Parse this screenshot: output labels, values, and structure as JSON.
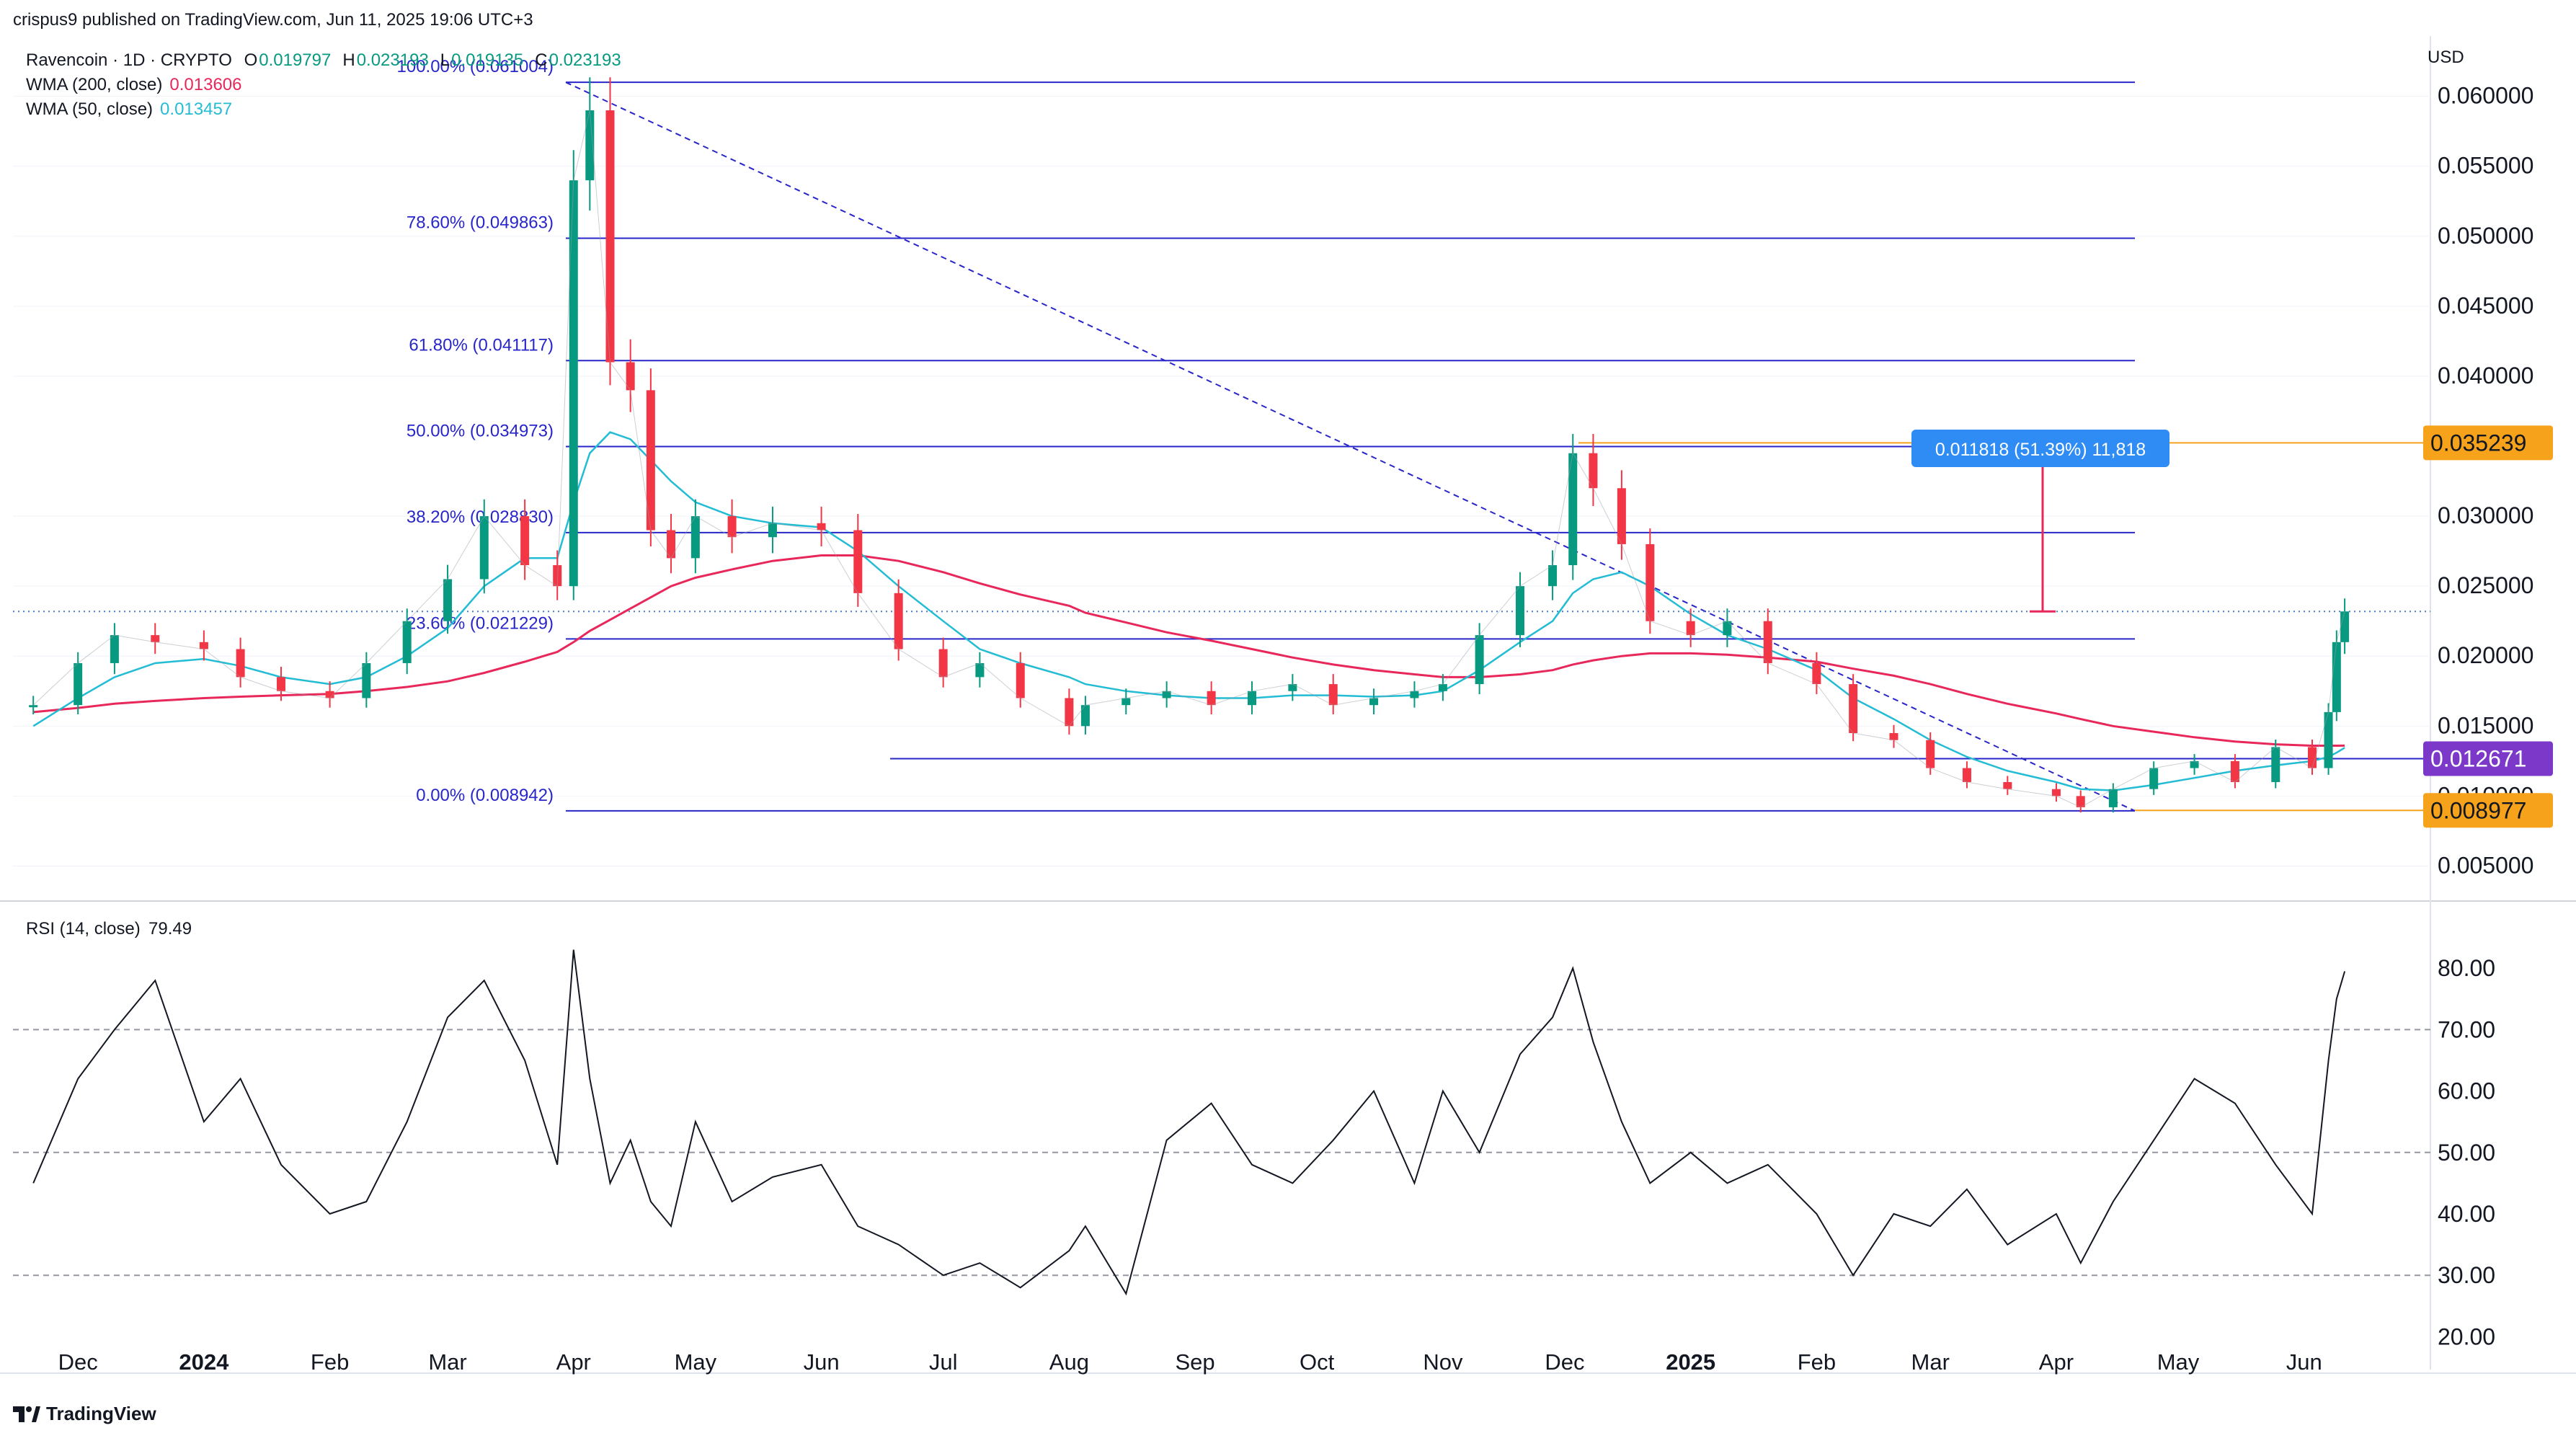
{
  "header": {
    "published": "crispus9 published on TradingView.com, Jun 11, 2025 19:06 UTC+3"
  },
  "symbol": {
    "name": "Ravencoin · 1D · CRYPTO",
    "ohlc": [
      {
        "k": "O",
        "v": "0.019797"
      },
      {
        "k": "H",
        "v": "0.023193"
      },
      {
        "k": "L",
        "v": "0.019135"
      },
      {
        "k": "C",
        "v": "0.023193"
      }
    ]
  },
  "indicators": [
    {
      "label": "WMA (200, close)",
      "value": "0.013606",
      "color": "#e8275a"
    },
    {
      "label": "WMA (50, close)",
      "value": "0.013457",
      "color": "#26bcd3"
    }
  ],
  "currency": "USD",
  "colors": {
    "up": "#089981",
    "down": "#f23645",
    "wma200": "#e8275a",
    "wma50": "#22bcd4",
    "fib": "#2826c9",
    "support_label": "#7b38c9",
    "orange": "#f7a21b",
    "measure": "#e8275a",
    "measure_label": "#2f8cf5",
    "grid": "#f0f3fa",
    "text": "#131722"
  },
  "price_axis": {
    "ticks": [
      "0.060000",
      "0.055000",
      "0.050000",
      "0.045000",
      "0.040000",
      "0.030000",
      "0.025000",
      "0.020000",
      "0.015000",
      "0.010000",
      "0.005000"
    ],
    "tick_values": [
      0.06,
      0.055,
      0.05,
      0.045,
      0.04,
      0.03,
      0.025,
      0.02,
      0.015,
      0.01,
      0.005
    ],
    "range": [
      0.0025,
      0.064
    ]
  },
  "highlights": [
    {
      "label": "0.035239",
      "value": 0.035239,
      "style": "orange"
    },
    {
      "label": "0.012671",
      "value": 0.012671,
      "style": "purple"
    },
    {
      "label": "0.008977",
      "value": 0.008977,
      "style": "orange"
    }
  ],
  "fib_levels": [
    {
      "label": "100.00% (0.061004)",
      "value": 0.061004
    },
    {
      "label": "78.60% (0.049863)",
      "value": 0.049863
    },
    {
      "label": "61.80% (0.041117)",
      "value": 0.041117
    },
    {
      "label": "50.00% (0.034973)",
      "value": 0.034973
    },
    {
      "label": "38.20% (0.028830)",
      "value": 0.02883
    },
    {
      "label": "23.60% (0.021229)",
      "value": 0.021229
    },
    {
      "label": "0.00% (0.008942)",
      "value": 0.008942
    }
  ],
  "measure": {
    "label": "0.011818 (51.39%) 11,818",
    "from": 0.023193,
    "to": 0.035239
  },
  "time_axis": [
    {
      "label": "Dec",
      "bold": false
    },
    {
      "label": "2024",
      "bold": true
    },
    {
      "label": "Feb",
      "bold": false
    },
    {
      "label": "Mar",
      "bold": false
    },
    {
      "label": "Apr",
      "bold": false
    },
    {
      "label": "May",
      "bold": false
    },
    {
      "label": "Jun",
      "bold": false
    },
    {
      "label": "Jul",
      "bold": false
    },
    {
      "label": "Aug",
      "bold": false
    },
    {
      "label": "Sep",
      "bold": false
    },
    {
      "label": "Oct",
      "bold": false
    },
    {
      "label": "Nov",
      "bold": false
    },
    {
      "label": "Dec",
      "bold": false
    },
    {
      "label": "2025",
      "bold": true
    },
    {
      "label": "Feb",
      "bold": false
    },
    {
      "label": "Mar",
      "bold": false
    },
    {
      "label": "Apr",
      "bold": false
    },
    {
      "label": "May",
      "bold": false
    },
    {
      "label": "Jun",
      "bold": false
    }
  ],
  "rsi": {
    "label": "RSI (14, close)",
    "value": "79.49",
    "ticks": [
      "80.00",
      "70.00",
      "60.00",
      "50.00",
      "40.00",
      "30.00",
      "20.00"
    ],
    "tick_values": [
      80,
      70,
      60,
      50,
      40,
      30,
      20
    ],
    "bands": [
      70,
      50,
      30
    ],
    "range": [
      17,
      88
    ]
  },
  "footer": {
    "brand": "TradingView"
  },
  "chart_data": {
    "type": "line",
    "title": "Ravencoin · 1D · CRYPTO",
    "xlabel": "",
    "ylabel": "",
    "ylim": [
      0.0025,
      0.064
    ],
    "x": [
      "2023-11-20",
      "2023-12-01",
      "2023-12-10",
      "2023-12-20",
      "2024-01-01",
      "2024-01-10",
      "2024-01-20",
      "2024-02-01",
      "2024-02-10",
      "2024-02-20",
      "2024-03-01",
      "2024-03-10",
      "2024-03-20",
      "2024-03-28",
      "2024-04-01",
      "2024-04-05",
      "2024-04-10",
      "2024-04-15",
      "2024-04-20",
      "2024-04-25",
      "2024-05-01",
      "2024-05-10",
      "2024-05-20",
      "2024-06-01",
      "2024-06-10",
      "2024-06-20",
      "2024-07-01",
      "2024-07-10",
      "2024-07-20",
      "2024-08-01",
      "2024-08-05",
      "2024-08-15",
      "2024-08-25",
      "2024-09-05",
      "2024-09-15",
      "2024-09-25",
      "2024-10-05",
      "2024-10-15",
      "2024-10-25",
      "2024-11-01",
      "2024-11-10",
      "2024-11-20",
      "2024-11-28",
      "2024-12-03",
      "2024-12-08",
      "2024-12-15",
      "2024-12-22",
      "2025-01-01",
      "2025-01-10",
      "2025-01-20",
      "2025-02-01",
      "2025-02-10",
      "2025-02-20",
      "2025-03-01",
      "2025-03-10",
      "2025-03-20",
      "2025-04-01",
      "2025-04-07",
      "2025-04-15",
      "2025-04-25",
      "2025-05-05",
      "2025-05-15",
      "2025-05-25",
      "2025-06-03",
      "2025-06-07",
      "2025-06-09",
      "2025-06-11"
    ],
    "series": [
      {
        "values": [
          0.0165,
          0.0195,
          0.0215,
          0.021,
          0.0205,
          0.0185,
          0.0175,
          0.017,
          0.0195,
          0.0225,
          0.0255,
          0.03,
          0.0265,
          0.025,
          0.054,
          0.059,
          0.041,
          0.039,
          0.029,
          0.027,
          0.03,
          0.0285,
          0.0295,
          0.029,
          0.0245,
          0.0205,
          0.0185,
          0.0195,
          0.017,
          0.015,
          0.0165,
          0.017,
          0.0175,
          0.0165,
          0.0175,
          0.018,
          0.0165,
          0.017,
          0.0175,
          0.018,
          0.0215,
          0.025,
          0.0265,
          0.0345,
          0.032,
          0.028,
          0.0225,
          0.0215,
          0.0225,
          0.0195,
          0.018,
          0.0145,
          0.014,
          0.012,
          0.011,
          0.0105,
          0.01,
          0.0092,
          0.0105,
          0.012,
          0.0125,
          0.011,
          0.0135,
          0.012,
          0.016,
          0.021,
          0.023193
        ]
      },
      {
        "name": "WMA (200, close)",
        "values": [
          0.016,
          0.0163,
          0.0166,
          0.0168,
          0.017,
          0.0171,
          0.0172,
          0.0173,
          0.0175,
          0.0178,
          0.0182,
          0.0188,
          0.0196,
          0.0203,
          0.021,
          0.0218,
          0.0226,
          0.0234,
          0.0242,
          0.025,
          0.0256,
          0.0262,
          0.0268,
          0.0272,
          0.0272,
          0.0268,
          0.026,
          0.0252,
          0.0244,
          0.0236,
          0.0231,
          0.0224,
          0.0217,
          0.0211,
          0.0205,
          0.0199,
          0.0194,
          0.019,
          0.0187,
          0.0185,
          0.0185,
          0.0187,
          0.019,
          0.0194,
          0.0197,
          0.02,
          0.0202,
          0.0202,
          0.0201,
          0.0199,
          0.0196,
          0.0191,
          0.0186,
          0.018,
          0.0173,
          0.0166,
          0.0159,
          0.0155,
          0.015,
          0.0146,
          0.0142,
          0.0139,
          0.0137,
          0.0136,
          0.0136,
          0.0136,
          0.013606
        ]
      },
      {
        "name": "WMA (50, close)",
        "values": [
          0.015,
          0.017,
          0.0185,
          0.0195,
          0.0198,
          0.0193,
          0.0185,
          0.018,
          0.0185,
          0.02,
          0.022,
          0.025,
          0.027,
          0.027,
          0.031,
          0.0345,
          0.036,
          0.0355,
          0.034,
          0.0325,
          0.031,
          0.03,
          0.0295,
          0.0292,
          0.0275,
          0.025,
          0.0225,
          0.0205,
          0.0195,
          0.0185,
          0.018,
          0.0175,
          0.0172,
          0.017,
          0.017,
          0.0172,
          0.0172,
          0.0171,
          0.0172,
          0.0175,
          0.019,
          0.021,
          0.0225,
          0.0245,
          0.0255,
          0.026,
          0.025,
          0.023,
          0.0215,
          0.0205,
          0.019,
          0.017,
          0.0155,
          0.014,
          0.0128,
          0.0118,
          0.011,
          0.0105,
          0.0104,
          0.0108,
          0.0113,
          0.0118,
          0.0122,
          0.0125,
          0.0128,
          0.0131,
          0.013457
        ]
      }
    ]
  },
  "rsi_data": {
    "x_count": 67,
    "values": [
      45,
      62,
      70,
      78,
      55,
      62,
      48,
      40,
      42,
      55,
      72,
      78,
      65,
      48,
      83,
      62,
      45,
      52,
      42,
      38,
      55,
      42,
      46,
      48,
      38,
      35,
      30,
      32,
      28,
      34,
      38,
      27,
      52,
      58,
      48,
      45,
      52,
      60,
      45,
      60,
      50,
      66,
      72,
      80,
      68,
      55,
      45,
      50,
      45,
      48,
      40,
      30,
      40,
      38,
      44,
      35,
      40,
      32,
      42,
      52,
      62,
      58,
      48,
      40,
      65,
      75,
      79.49
    ]
  }
}
